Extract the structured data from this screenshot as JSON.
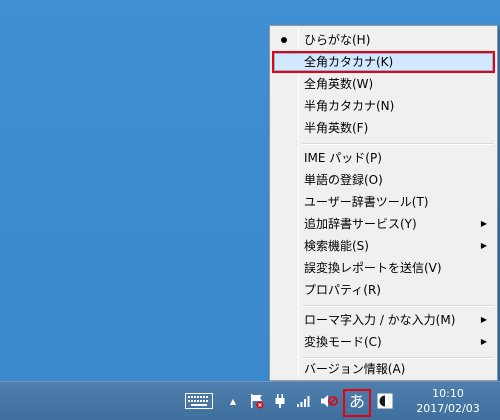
{
  "menu": {
    "items": [
      {
        "label": "ひらがな(H)",
        "selected": true,
        "submenu": false
      },
      {
        "label": "全角カタカナ(K)",
        "selected": false,
        "highlighted": true,
        "submenu": false
      },
      {
        "label": "全角英数(W)",
        "selected": false,
        "submenu": false
      },
      {
        "label": "半角カタカナ(N)",
        "selected": false,
        "submenu": false
      },
      {
        "label": "半角英数(F)",
        "selected": false,
        "submenu": false
      },
      {
        "label": "IME パッド(P)",
        "selected": false,
        "submenu": false
      },
      {
        "label": "単語の登録(O)",
        "selected": false,
        "submenu": false
      },
      {
        "label": "ユーザー辞書ツール(T)",
        "selected": false,
        "submenu": false
      },
      {
        "label": "追加辞書サービス(Y)",
        "selected": false,
        "submenu": true
      },
      {
        "label": "検索機能(S)",
        "selected": false,
        "submenu": true
      },
      {
        "label": "誤変換レポートを送信(V)",
        "selected": false,
        "submenu": false
      },
      {
        "label": "プロパティ(R)",
        "selected": false,
        "submenu": false
      },
      {
        "label": "ローマ字入力 / かな入力(M)",
        "selected": false,
        "submenu": true
      },
      {
        "label": "変換モード(C)",
        "selected": false,
        "submenu": true
      },
      {
        "label": "バージョン情報(A)",
        "selected": false,
        "submenu": false
      }
    ]
  },
  "taskbar": {
    "ime_mode_glyph": "あ",
    "time": "10:10",
    "date": "2017/02/03",
    "icons": [
      "keyboard-icon",
      "show-hidden-icons-arrow",
      "action-center-flag-icon",
      "power-plug-icon",
      "network-signal-icon",
      "volume-muted-icon",
      "ime-mode-icon",
      "ime-status-icon"
    ]
  },
  "colors": {
    "desktop": "#3d8bd0",
    "taskbar": "#4676a4",
    "highlight_bg": "#d1e8ff",
    "annotation_red": "#e8000d"
  }
}
